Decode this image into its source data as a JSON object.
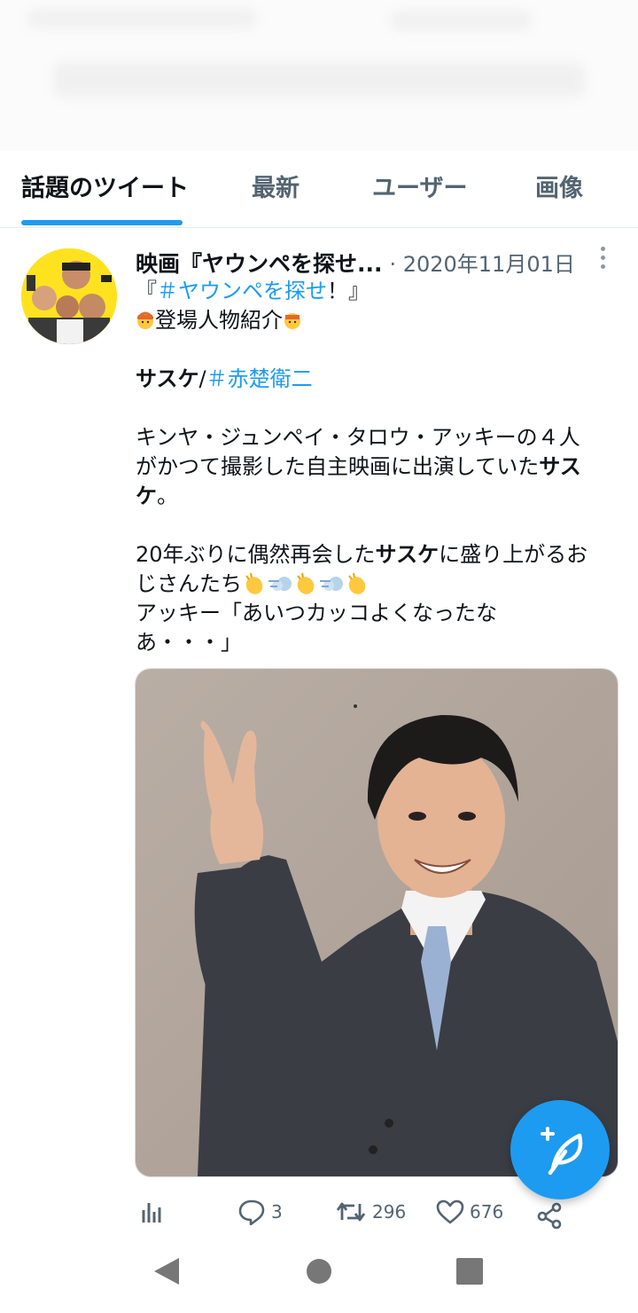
{
  "tabs": [
    {
      "label": "話題のツイート",
      "active": true
    },
    {
      "label": "最新"
    },
    {
      "label": "ユーザー"
    },
    {
      "label": "画像"
    }
  ],
  "tweet": {
    "author": "映画『ヤウンペを探せ...",
    "date": "· 2020年11月01日",
    "line1_open": "『",
    "line1_hashtag": "＃ヤウンペを探せ",
    "line1_close": "！』",
    "line2": "登場人物紹介",
    "line3_name": "サスケ",
    "line3_sep": "/",
    "line3_hashtag": "＃赤楚衛二",
    "para1_line1": "キンヤ・ジュンペイ・タロウ・アッキーの４人",
    "para1_line2_a": "がかつて撮影した自主映画に出演していた",
    "para1_line2_b": "サス",
    "para1_line3_a": "ケ",
    "para1_line3_b": "。",
    "para2_line1_a": "20年ぶりに偶然再会した",
    "para2_line1_b": "サスケ",
    "para2_line1_c": "に盛り上がるお",
    "para2_line2": "じさんたち",
    "para2_line3": "アッキー「あいつカッコよくなったな",
    "para2_line4": "あ・・・」"
  },
  "actions": {
    "replies": "3",
    "retweets": "296",
    "likes": "676"
  },
  "colors": {
    "accent": "#1d9bf0",
    "text": "#0f1419",
    "muted": "#536471"
  },
  "icons": [
    "analytics-icon",
    "reply-icon",
    "retweet-icon",
    "like-icon",
    "share-icon",
    "compose-tweet-icon",
    "nav-back-icon",
    "nav-home-icon",
    "nav-recents-icon",
    "more-options-icon"
  ]
}
